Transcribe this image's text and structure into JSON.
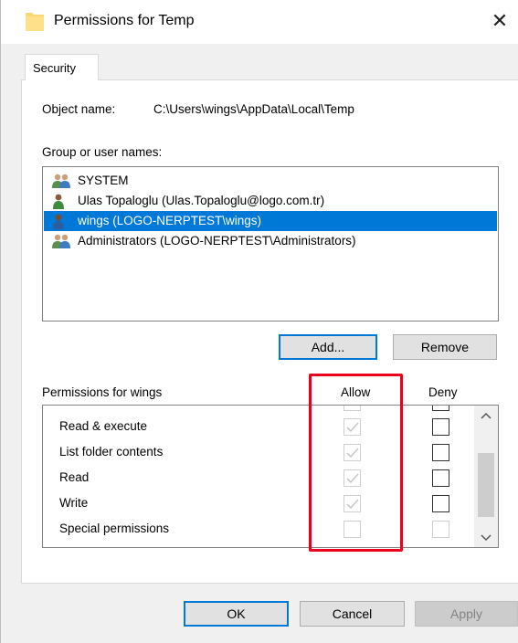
{
  "window": {
    "title": "Permissions for Temp",
    "close_glyph": "✕"
  },
  "tabs": [
    {
      "label": "Security"
    }
  ],
  "object": {
    "label": "Object name:",
    "value": "C:\\Users\\wings\\AppData\\Local\\Temp"
  },
  "group_label": "Group or user names:",
  "users": [
    {
      "name": "SYSTEM",
      "icon": "group-users-icon",
      "selected": false
    },
    {
      "name": "Ulas Topaloglu (Ulas.Topaloglu@logo.com.tr)",
      "icon": "user-icon",
      "selected": false
    },
    {
      "name": "wings (LOGO-NERPTEST\\wings)",
      "icon": "user-icon",
      "selected": true
    },
    {
      "name": "Administrators (LOGO-NERPTEST\\Administrators)",
      "icon": "group-users-icon",
      "selected": false
    }
  ],
  "buttons": {
    "add": "Add...",
    "remove": "Remove",
    "ok": "OK",
    "cancel": "Cancel",
    "apply": "Apply"
  },
  "permissions": {
    "header": "Permissions for wings",
    "allow_label": "Allow",
    "deny_label": "Deny",
    "rows": [
      {
        "name": "Read & execute",
        "allow": true,
        "deny": false,
        "inherited": true
      },
      {
        "name": "List folder contents",
        "allow": true,
        "deny": false,
        "inherited": true
      },
      {
        "name": "Read",
        "allow": true,
        "deny": false,
        "inherited": true
      },
      {
        "name": "Write",
        "allow": true,
        "deny": false,
        "inherited": true
      },
      {
        "name": "Special permissions",
        "allow": false,
        "deny": false,
        "inherited": true
      }
    ]
  },
  "colors": {
    "selection": "#0078d7",
    "highlight": "#e8001c"
  }
}
